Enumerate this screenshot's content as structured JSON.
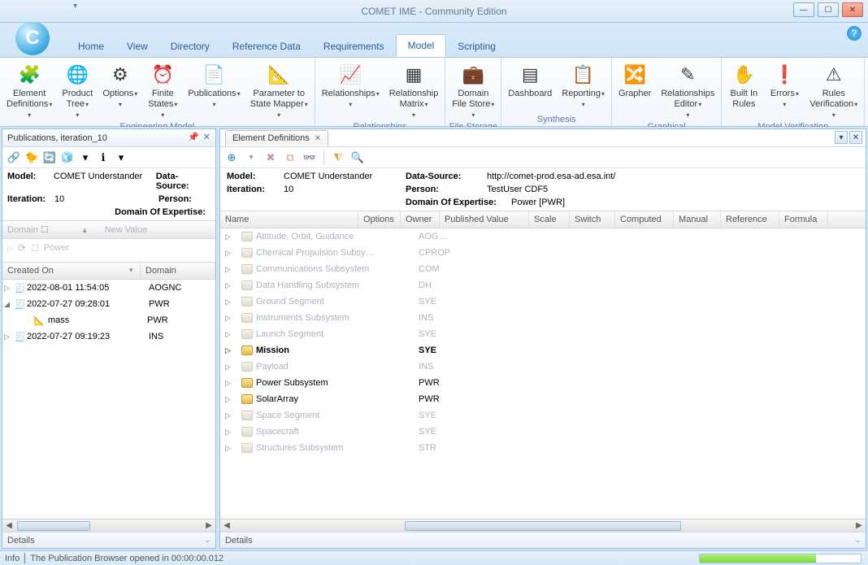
{
  "window": {
    "title": "COMET IME - Community Edition",
    "quick_dd": "▾"
  },
  "menu": {
    "items": [
      "Home",
      "View",
      "Directory",
      "Reference Data",
      "Requirements",
      "Model",
      "Scripting"
    ],
    "active_index": 5
  },
  "ribbon": {
    "groups": [
      {
        "id": "eng",
        "label": "Engineering Model",
        "buttons": [
          {
            "id": "eldef",
            "label": "Element\nDefinitions",
            "dd": true
          },
          {
            "id": "ptree",
            "label": "Product\nTree",
            "dd": true
          },
          {
            "id": "opts",
            "label": "Options",
            "dd": true
          },
          {
            "id": "fst",
            "label": "Finite\nStates",
            "dd": true
          },
          {
            "id": "pubs",
            "label": "Publications",
            "dd": true
          },
          {
            "id": "p2sm",
            "label": "Parameter to\nState Mapper",
            "dd": true
          }
        ]
      },
      {
        "id": "rel",
        "label": "Relationships",
        "buttons": [
          {
            "id": "rels",
            "label": "Relationships",
            "dd": true
          },
          {
            "id": "relmx",
            "label": "Relationship\nMatrix",
            "dd": true
          }
        ]
      },
      {
        "id": "fs",
        "label": "File Storage",
        "buttons": [
          {
            "id": "dfs",
            "label": "Domain\nFile Store",
            "dd": true
          }
        ]
      },
      {
        "id": "syn",
        "label": "Synthesis",
        "buttons": [
          {
            "id": "dash",
            "label": "Dashboard",
            "dd": false
          },
          {
            "id": "rep",
            "label": "Reporting",
            "dd": true
          }
        ]
      },
      {
        "id": "gra",
        "label": "Graphical",
        "buttons": [
          {
            "id": "grapher",
            "label": "Grapher",
            "dd": false
          },
          {
            "id": "redit",
            "label": "Relationships\nEditor",
            "dd": true
          }
        ]
      },
      {
        "id": "mv",
        "label": "Model Verification",
        "buttons": [
          {
            "id": "brules",
            "label": "Built In\nRules",
            "dd": false
          },
          {
            "id": "errs",
            "label": "Errors",
            "dd": true
          },
          {
            "id": "rver",
            "label": "Rules\nVerification",
            "dd": true
          }
        ]
      }
    ]
  },
  "left_panel": {
    "title": "Publications, iteration_10",
    "toolbar": [
      "🔗",
      "🦆",
      "🔄",
      "🧊",
      "▾",
      "ℹ",
      "▾"
    ],
    "meta": {
      "model_label": "Model:",
      "model": "COMET Understander",
      "ds_label": "Data-Source:",
      "ds": "",
      "iter_label": "Iteration:",
      "iter": "10",
      "person_label": "Person:",
      "person": "",
      "doe_label": "Domain Of Expertise:",
      "doe": ""
    },
    "filter": {
      "domain": "Domain",
      "new_value": "New Value",
      "power": "Power"
    },
    "grid": {
      "cols": [
        "Created On",
        "Domain"
      ],
      "rows": [
        {
          "exp": "▷",
          "created": "2022-08-01 11:54:05",
          "domain": "AOGNC",
          "children": []
        },
        {
          "exp": "◢",
          "created": "2022-07-27 09:28:01",
          "domain": "PWR",
          "children": [
            {
              "label": "mass",
              "domain": "PWR"
            }
          ]
        },
        {
          "exp": "▷",
          "created": "2022-07-27 09:19:23",
          "domain": "INS",
          "children": []
        }
      ]
    },
    "details": "Details"
  },
  "right_panel": {
    "tab_title": "Element Definitions",
    "toolbar": [
      "⊕",
      "▾",
      "✖",
      "⧉",
      "🔍",
      "|",
      "⚗",
      "🔎"
    ],
    "meta": {
      "model_label": "Model:",
      "model": "COMET Understander",
      "ds_label": "Data-Source:",
      "ds": "http://comet-prod.esa-ad.esa.int/",
      "iter_label": "Iteration:",
      "iter": "10",
      "person_label": "Person:",
      "person": "TestUser CDF5",
      "doe_label": "Domain Of Expertise:",
      "doe": "Power [PWR]"
    },
    "columns": [
      "Name",
      "Options",
      "Owner",
      "Published Value",
      "Scale",
      "Switch",
      "Computed",
      "Manual",
      "Reference",
      "Formula"
    ],
    "rows": [
      {
        "name": "Attitude, Orbit, Guidance",
        "owner": "AOG…",
        "faded": true
      },
      {
        "name": "Chemical Propulsion Subsystem",
        "owner": "CPROP",
        "faded": true
      },
      {
        "name": "Communications Subsystem",
        "owner": "COM",
        "faded": true
      },
      {
        "name": "Data Handling Subsystem",
        "owner": "DH",
        "faded": true
      },
      {
        "name": "Ground Segment",
        "owner": "SYE",
        "faded": true
      },
      {
        "name": "Instruments Subsystem",
        "owner": "INS",
        "faded": true
      },
      {
        "name": "Launch Segment",
        "owner": "SYE",
        "faded": true
      },
      {
        "name": "Mission",
        "owner": "SYE",
        "bold": true
      },
      {
        "name": "Payload",
        "owner": "INS",
        "faded": true
      },
      {
        "name": "Power Subsystem",
        "owner": "PWR"
      },
      {
        "name": "SolarArray",
        "owner": "PWR"
      },
      {
        "name": "Space Segment",
        "owner": "SYE",
        "faded": true
      },
      {
        "name": "Spacecraft",
        "owner": "SYE",
        "faded": true
      },
      {
        "name": "Structures Subsystem",
        "owner": "STR",
        "faded": true
      }
    ],
    "details": "Details"
  },
  "status": {
    "info": "Info",
    "msg": "The Publication Browser opened in 00:00:00.012",
    "progress_pct": 72
  },
  "icons": {
    "eldef": "🧩",
    "ptree": "🌐",
    "opts": "⚙",
    "fst": "⏰",
    "pubs": "📄",
    "p2sm": "📐",
    "rels": "📈",
    "relmx": "▦",
    "dfs": "💼",
    "dash": "▤",
    "rep": "📋",
    "grapher": "🔀",
    "redit": "✎",
    "brules": "✋",
    "errs": "❗",
    "rver": "⚠"
  }
}
